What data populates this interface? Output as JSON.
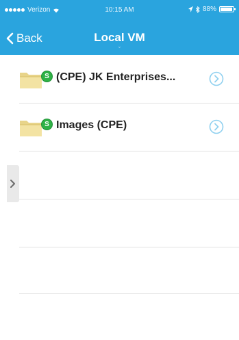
{
  "status_bar": {
    "carrier": "Verizon",
    "time": "10:15 AM",
    "battery": "88%"
  },
  "nav": {
    "back_label": "Back",
    "title": "Local VM",
    "title_caret": "ˇ"
  },
  "list": {
    "items": [
      {
        "label": "(CPE) JK Enterprises...",
        "icon": "folder-icon",
        "badge": "sync-badge-icon",
        "accessory": "detail-disclosure-icon"
      },
      {
        "label": "Images (CPE)",
        "icon": "folder-icon",
        "badge": "sync-badge-icon",
        "accessory": "detail-disclosure-icon"
      }
    ]
  },
  "colors": {
    "header": "#2aa4de",
    "accent": "#2aa4de",
    "badge": "#2fb246",
    "separator": "#e2e2e2"
  }
}
